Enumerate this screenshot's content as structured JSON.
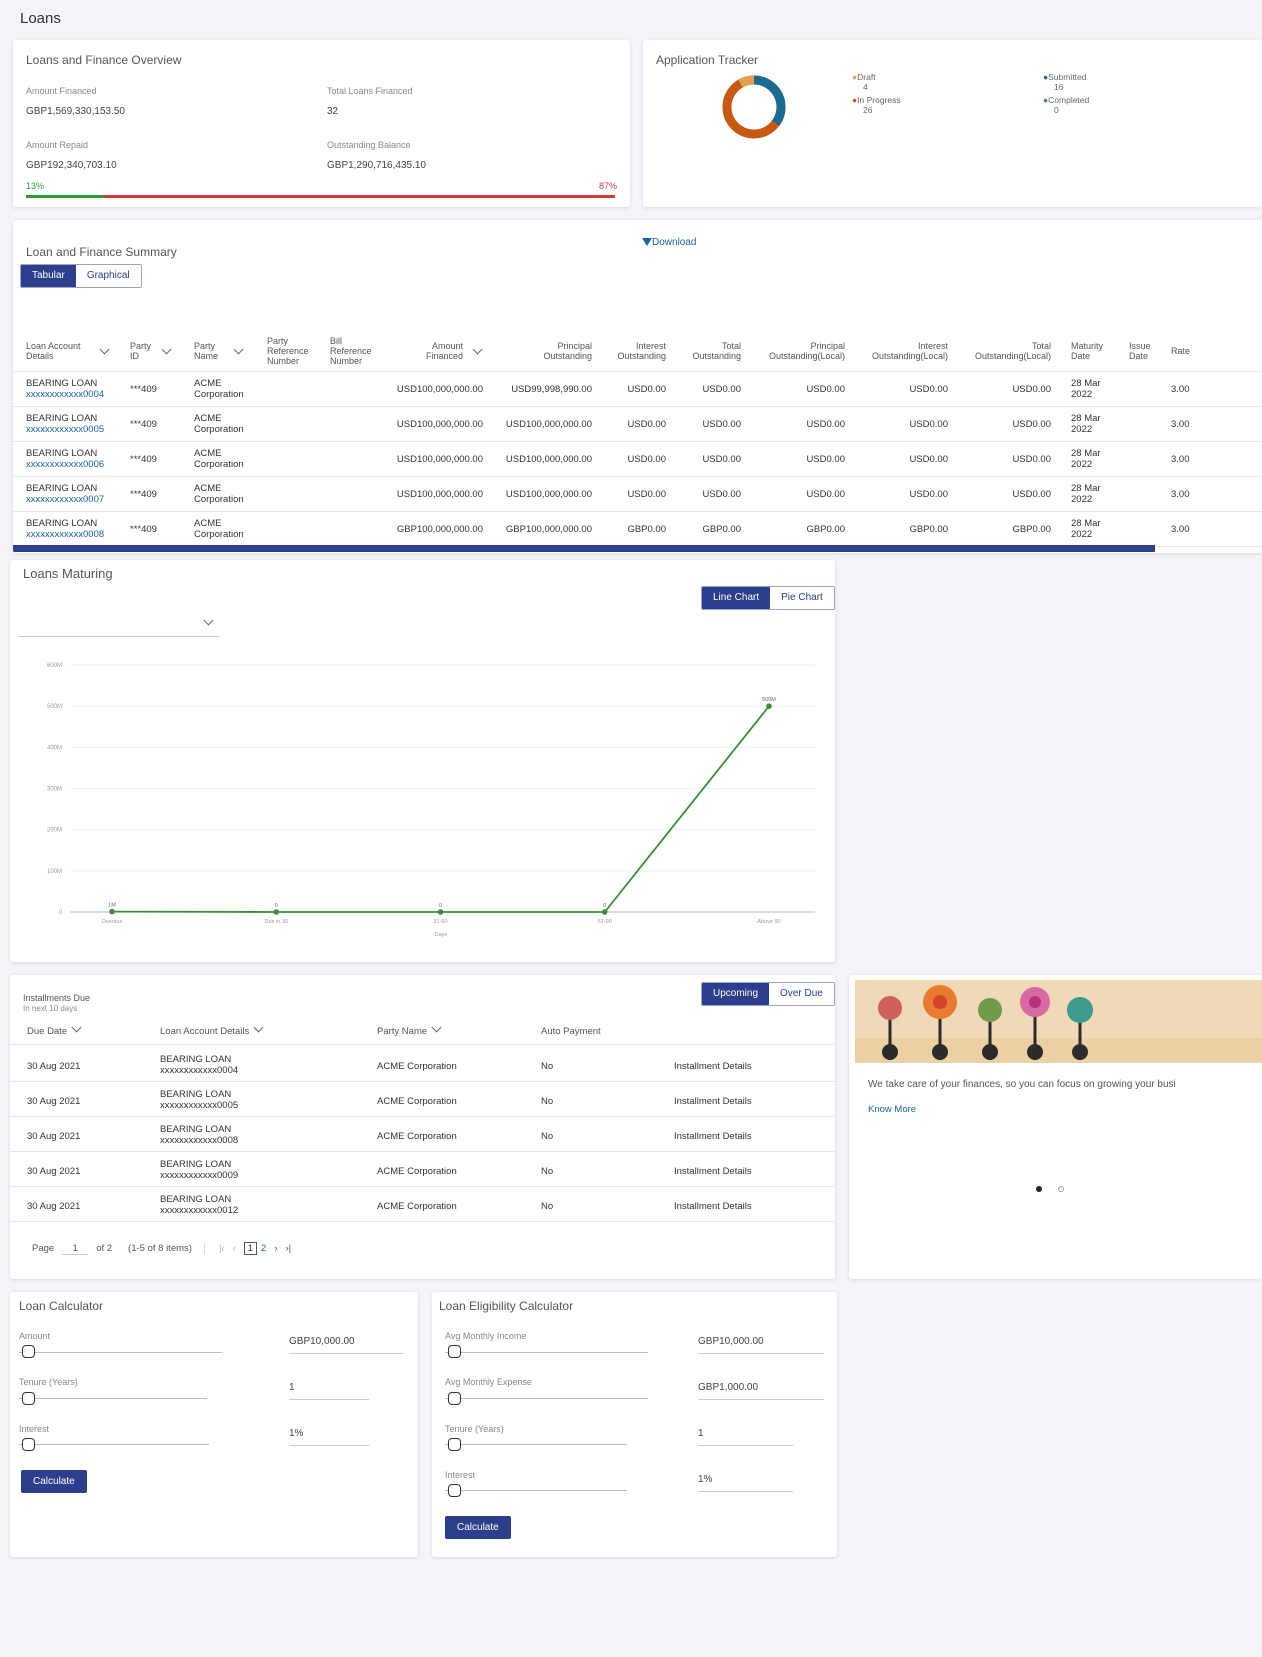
{
  "page_title": "Loans",
  "overview": {
    "title": "Loans and Finance Overview",
    "amount_financed_label": "Amount Financed",
    "amount_financed": "GBP1,569,330,153.50",
    "total_loans_label": "Total Loans Financed",
    "total_loans": "32",
    "amount_repaid_label": "Amount Repaid",
    "amount_repaid": "GBP192,340,703.10",
    "outstanding_label": "Outstanding Balance",
    "outstanding": "GBP1,290,716,435.10",
    "repaid_pct_label": "13%",
    "repaid_fraction": 0.13,
    "outstanding_pct_label": "87%",
    "colors": {
      "repaid": "#2e9a3a",
      "outstanding": "#d23b3b"
    }
  },
  "tracker": {
    "title": "Application Tracker",
    "items": [
      {
        "label": "Draft",
        "count": "4",
        "color": "#e0a050"
      },
      {
        "label": "In Progress",
        "count": "26",
        "color": "#c8580f"
      },
      {
        "label": "Submitted",
        "count": "16",
        "color": "#186c94"
      },
      {
        "label": "Completed",
        "count": "0",
        "color": "#2e9a3a"
      }
    ]
  },
  "summary": {
    "title": "Loan and Finance Summary",
    "download": "Download",
    "tabs": [
      "Tabular",
      "Graphical"
    ],
    "headers": [
      "Loan Account Details",
      "Party ID",
      "Party Name",
      "Party Reference Number",
      "Bill Reference Number",
      "Amount Financed",
      "Principal Outstanding",
      "Interest Outstanding",
      "Total Outstanding",
      "Principal Outstanding(Local)",
      "Interest Outstanding(Local)",
      "Total Outstanding(Local)",
      "Maturity Date",
      "Issue Date",
      "Rate"
    ],
    "rows": [
      {
        "name": "BEARING LOAN",
        "acct": "xxxxxxxxxxxx0004",
        "party_id": "***409",
        "party_name": "ACME Corporation",
        "amount": "USD100,000,000.00",
        "principal": "USD99,998,990.00",
        "interest": "USD0.00",
        "total": "USD0.00",
        "p_local": "USD0.00",
        "i_local": "USD0.00",
        "t_local": "USD0.00",
        "maturity": "28 Mar 2022",
        "rate": "3.00"
      },
      {
        "name": "BEARING LOAN",
        "acct": "xxxxxxxxxxxx0005",
        "party_id": "***409",
        "party_name": "ACME Corporation",
        "amount": "USD100,000,000.00",
        "principal": "USD100,000,000.00",
        "interest": "USD0.00",
        "total": "USD0.00",
        "p_local": "USD0.00",
        "i_local": "USD0.00",
        "t_local": "USD0.00",
        "maturity": "28 Mar 2022",
        "rate": "3.00"
      },
      {
        "name": "BEARING LOAN",
        "acct": "xxxxxxxxxxxx0006",
        "party_id": "***409",
        "party_name": "ACME Corporation",
        "amount": "USD100,000,000.00",
        "principal": "USD100,000,000.00",
        "interest": "USD0.00",
        "total": "USD0.00",
        "p_local": "USD0.00",
        "i_local": "USD0.00",
        "t_local": "USD0.00",
        "maturity": "28 Mar 2022",
        "rate": "3.00"
      },
      {
        "name": "BEARING LOAN",
        "acct": "xxxxxxxxxxxx0007",
        "party_id": "***409",
        "party_name": "ACME Corporation",
        "amount": "USD100,000,000.00",
        "principal": "USD100,000,000.00",
        "interest": "USD0.00",
        "total": "USD0.00",
        "p_local": "USD0.00",
        "i_local": "USD0.00",
        "t_local": "USD0.00",
        "maturity": "28 Mar 2022",
        "rate": "3.00"
      },
      {
        "name": "BEARING LOAN",
        "acct": "xxxxxxxxxxxx0008",
        "party_id": "***409",
        "party_name": "ACME Corporation",
        "amount": "GBP100,000,000.00",
        "principal": "GBP100,000,000.00",
        "interest": "GBP0.00",
        "total": "GBP0.00",
        "p_local": "GBP0.00",
        "i_local": "GBP0.00",
        "t_local": "GBP0.00",
        "maturity": "28 Mar 2022",
        "rate": "3.00"
      }
    ]
  },
  "maturing": {
    "title": "Loans Maturing",
    "tabs": [
      "Line Chart",
      "Pie Chart"
    ]
  },
  "chart_data": {
    "type": "line",
    "categories": [
      "Overdue",
      "Due in 30",
      "31-60",
      "61-90",
      "Above 90"
    ],
    "values": [
      1,
      0,
      0,
      0,
      500
    ],
    "data_labels": [
      "1M",
      "0",
      "0",
      "0",
      "500M"
    ],
    "ylim": [
      0,
      600
    ],
    "yticks": [
      "0",
      "100M",
      "200M",
      "300M",
      "400M",
      "500M",
      "600M"
    ],
    "xlabel": "Days",
    "ylabel": "",
    "color": "#3a8e3a",
    "grid": true
  },
  "installments": {
    "title": "Installments Due",
    "subtitle": "In next 10 days",
    "tabs": [
      "Upcoming",
      "Over Due"
    ],
    "headers": [
      "Due Date",
      "Loan Account Details",
      "Party Name",
      "Auto Payment"
    ],
    "rows": [
      {
        "date": "30 Aug 2021",
        "name": "BEARING LOAN",
        "acct": "xxxxxxxxxxxx0004",
        "party": "ACME Corporation",
        "auto": "No",
        "link": "Installment Details"
      },
      {
        "date": "30 Aug 2021",
        "name": "BEARING LOAN",
        "acct": "xxxxxxxxxxxx0005",
        "party": "ACME Corporation",
        "auto": "No",
        "link": "Installment Details"
      },
      {
        "date": "30 Aug 2021",
        "name": "BEARING LOAN",
        "acct": "xxxxxxxxxxxx0008",
        "party": "ACME Corporation",
        "auto": "No",
        "link": "Installment Details"
      },
      {
        "date": "30 Aug 2021",
        "name": "BEARING LOAN",
        "acct": "xxxxxxxxxxxx0009",
        "party": "ACME Corporation",
        "auto": "No",
        "link": "Installment Details"
      },
      {
        "date": "30 Aug 2021",
        "name": "BEARING LOAN",
        "acct": "xxxxxxxxxxxx0012",
        "party": "ACME Corporation",
        "auto": "No",
        "link": "Installment Details"
      }
    ],
    "pager": {
      "page_label": "Page",
      "page": "1",
      "of": "of 2",
      "items": "(1-5 of 8 items)",
      "first": "|‹",
      "prev": "‹",
      "p1": "1",
      "p2": "2",
      "next": "›",
      "last": "›|"
    }
  },
  "promo": {
    "text": "We take care of your finances, so you can focus on growing your busi",
    "link": "Know More"
  },
  "loan_calc": {
    "title": "Loan Calculator",
    "amount_label": "Amount",
    "amount": "GBP10,000.00",
    "tenure_label": "Tenure (Years)",
    "tenure": "1",
    "interest_label": "Interest",
    "interest": "1%",
    "button": "Calculate"
  },
  "elig_calc": {
    "title": "Loan Eligibility Calculator",
    "income_label": "Avg Monthly Income",
    "income": "GBP10,000.00",
    "expense_label": "Avg Monthly Expense",
    "expense": "GBP1,000.00",
    "tenure_label": "Tenure (Years)",
    "tenure": "1",
    "interest_label": "Interest",
    "interest": "1%",
    "button": "Calculate"
  }
}
